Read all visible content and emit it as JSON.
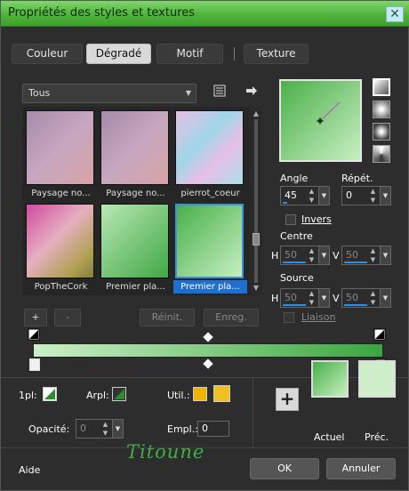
{
  "window": {
    "title": "Propriétés des styles et textures",
    "close_glyph": "✕"
  },
  "tabs": [
    {
      "label": "Couleur"
    },
    {
      "label": "Dégradé",
      "active": true
    },
    {
      "label": "Motif"
    },
    {
      "label": "Texture"
    }
  ],
  "category": {
    "value": "Tous",
    "arrow": "▼"
  },
  "gallery": {
    "items": [
      {
        "label": "Paysage no...",
        "colors": [
          "#c7a7c0",
          "#a58aa8",
          "#d7a4a5"
        ]
      },
      {
        "label": "Paysage no...",
        "colors": [
          "#c7a7c0",
          "#a58aa8",
          "#d7a4a5"
        ]
      },
      {
        "label": "pierrot_coeur",
        "colors": [
          "#9fd6e8",
          "#e7bfe6",
          "#a7e0e6"
        ]
      },
      {
        "label": "PopTheCork",
        "colors": [
          "#d24aa0",
          "#e6b0c0",
          "#b0a050"
        ]
      },
      {
        "label": "Premier pla...",
        "colors": [
          "#b9e8b4",
          "#3fa844"
        ]
      },
      {
        "label": "Premier pla...",
        "colors": [
          "#c7efc2",
          "#48b04a"
        ],
        "selected": true
      }
    ]
  },
  "gallery_buttons": {
    "add": "+",
    "remove": "-",
    "reset": "Réinit.",
    "save": "Enreg."
  },
  "angle": {
    "label": "Angle",
    "value": "45"
  },
  "repeat": {
    "label": "Répét.",
    "value": "0"
  },
  "invert": {
    "label": "Invers",
    "checked": false
  },
  "centre": {
    "label": "Centre",
    "h_label": "H",
    "h_value": "50",
    "v_label": "V",
    "v_value": "50"
  },
  "source": {
    "label": "Source",
    "h_label": "H",
    "h_value": "50",
    "v_label": "V",
    "v_value": "50"
  },
  "link": {
    "label": "Liaison",
    "checked": false
  },
  "gradient_editor": {
    "start_color": "#ccefc7",
    "end_color": "#3aa63f"
  },
  "stops": {
    "first_label": "1pl:",
    "arpl_label": "Arpl:",
    "util_label": "Util.:",
    "opacity_label": "Opacité:",
    "opacity_value": "0",
    "empl_label": "Empl.:",
    "empl_value": "0",
    "util_colors": [
      "#f0b400",
      "#f0c020"
    ]
  },
  "current": {
    "label": "Actuel",
    "color": "#6bc467"
  },
  "previous": {
    "label": "Préc.",
    "color": "#cdeec8"
  },
  "add_swatch": "+",
  "watermark": "Titoune",
  "footer": {
    "help": "Aide",
    "ok": "OK",
    "cancel": "Annuler"
  }
}
